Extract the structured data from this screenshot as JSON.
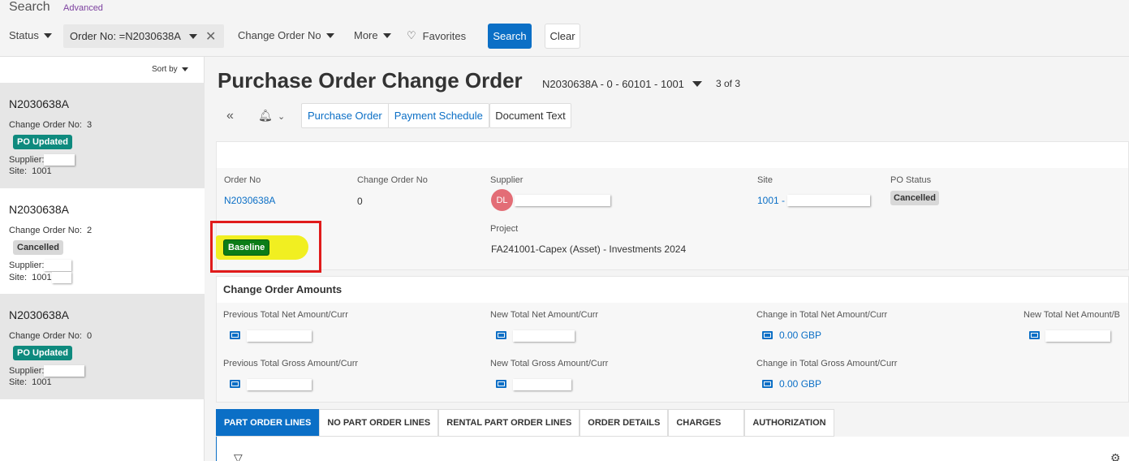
{
  "search": {
    "title": "Search",
    "advanced": "Advanced",
    "filters": {
      "status": "Status",
      "order_no_chip": "Order No: =N2030638A",
      "change_order_no": "Change Order No",
      "more": "More",
      "favorites": "Favorites"
    },
    "search_button": "Search",
    "clear_button": "Clear"
  },
  "list": {
    "sort_by": "Sort by",
    "cards": [
      {
        "title": "N2030638A",
        "co_label": "Change Order No:",
        "co_value": "3",
        "badge": "PO Updated",
        "supplier_label": "Supplier:",
        "site_label": "Site:",
        "site_value": "1001"
      },
      {
        "title": "N2030638A",
        "co_label": "Change Order No:",
        "co_value": "2",
        "badge": "Cancelled",
        "supplier_label": "Supplier:",
        "site_label": "Site:",
        "site_value": "1001"
      },
      {
        "title": "N2030638A",
        "co_label": "Change Order No:",
        "co_value": "0",
        "badge": "PO Updated",
        "supplier_label": "Supplier:",
        "site_label": "Site:",
        "site_value": "1001"
      }
    ]
  },
  "page": {
    "title": "Purchase Order Change Order",
    "record": "N2030638A - 0 - 60101 - 1001",
    "pager": "3 of 3",
    "nav_buttons": [
      "Purchase Order",
      "Payment Schedule"
    ],
    "doc_text_button": "Document Text"
  },
  "header_fields": {
    "order_no_label": "Order No",
    "order_no_value": "N2030638A",
    "change_order_no_label": "Change Order No",
    "change_order_no_value": "0",
    "supplier_label": "Supplier",
    "supplier_avatar": "DL",
    "site_label": "Site",
    "site_value": "1001 -",
    "po_status_label": "PO Status",
    "po_status_value": "Cancelled",
    "baseline_badge": "Baseline",
    "project_label": "Project",
    "project_value": "FA241001-Capex (Asset) - Investments 2024"
  },
  "amounts": {
    "title": "Change Order Amounts",
    "prev_net_label": "Previous Total Net Amount/Curr",
    "new_net_label": "New Total Net Amount/Curr",
    "change_net_label": "Change in Total Net Amount/Curr",
    "change_net_value": "0.00 GBP",
    "new_net_base_label": "New Total Net Amount/B",
    "prev_gross_label": "Previous Total Gross Amount/Curr",
    "new_gross_label": "New Total Gross Amount/Curr",
    "change_gross_label": "Change in Total Gross Amount/Curr",
    "change_gross_value": "0.00 GBP"
  },
  "tabs": [
    "PART ORDER LINES",
    "NO PART ORDER LINES",
    "RENTAL PART ORDER LINES",
    "ORDER DETAILS",
    "CHARGES",
    "AUTHORIZATION"
  ],
  "colors": {
    "accent": "#0b6fc6",
    "badge_green": "#0e8a7e",
    "baseline_green": "#0b7d17",
    "highlight": "#f1ef21",
    "annotation_red": "#e01b1b"
  }
}
